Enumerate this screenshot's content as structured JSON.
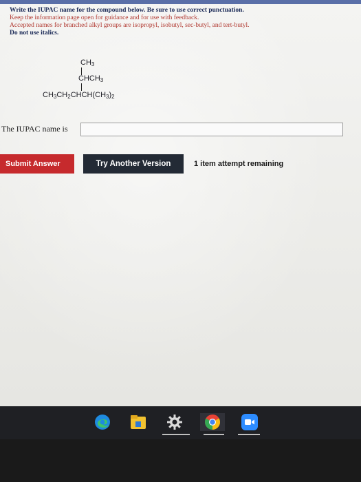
{
  "instructions": {
    "line1": "Write the IUPAC name for the compound below. Be sure to use correct punctuation.",
    "line2": "Keep the information page open for guidance and for use with feedback.",
    "line3": "Accepted names for branched alkyl groups are isopropyl, isobutyl, sec-butyl, and tert-butyl.",
    "line4": "Do not use italics."
  },
  "structure": {
    "top": "CH",
    "top_sub": "3",
    "middle": "CHCH",
    "middle_sub": "3",
    "main_a": "CH",
    "main_a_sub": "3",
    "main_b": "CH",
    "main_b_sub": "2",
    "main_c": "CHCH(CH",
    "main_c_sub": "3",
    "main_d": ")",
    "main_d_sub": "2"
  },
  "prompt": "The IUPAC name is",
  "answer": {
    "value": "",
    "placeholder": ""
  },
  "buttons": {
    "submit": "Submit Answer",
    "try_another": "Try Another Version"
  },
  "attempts": "1 item attempt remaining",
  "colors": {
    "submit": "#c62a2d",
    "try_another": "#232a35",
    "instruction_red": "#b0372f",
    "instruction_blue": "#1b2a57"
  },
  "taskbar": {
    "icons": [
      "edge-icon",
      "file-explorer-icon",
      "settings-icon",
      "chrome-icon",
      "zoom-icon"
    ]
  }
}
